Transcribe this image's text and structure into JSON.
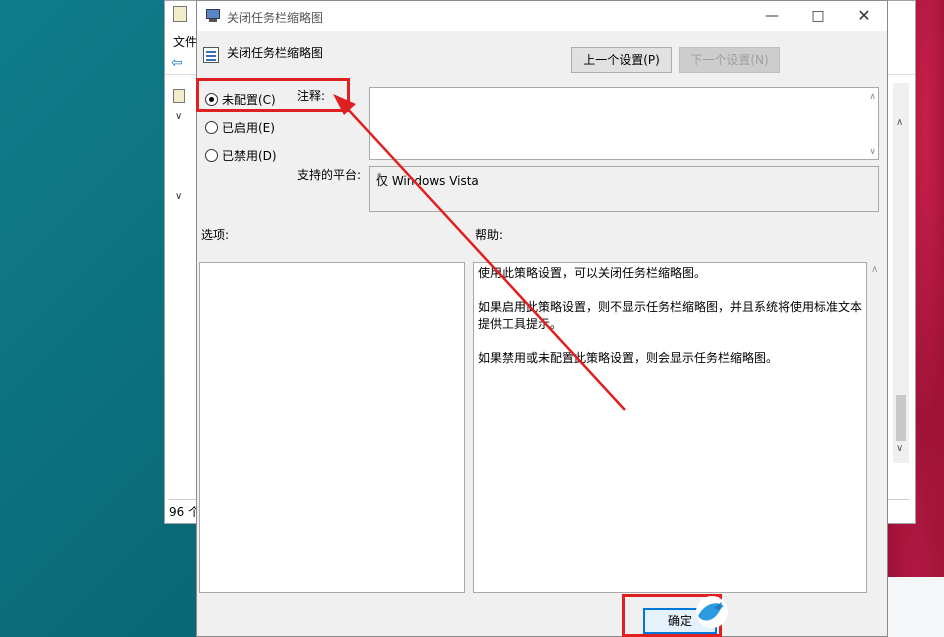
{
  "background_window": {
    "menu_file": "文件",
    "status_text": "96 个"
  },
  "dialog": {
    "title": "关闭任务栏缩略图",
    "policy_name": "关闭任务栏缩略图",
    "prev_button": "上一个设置(P)",
    "next_button": "下一个设置(N)",
    "radios": [
      {
        "label": "未配置(C)",
        "selected": true
      },
      {
        "label": "已启用(E)",
        "selected": false
      },
      {
        "label": "已禁用(D)",
        "selected": false
      }
    ],
    "comment_label": "注释:",
    "comment_value": "",
    "platform_label": "支持的平台:",
    "platform_value": "仅 Windows Vista",
    "options_label": "选项:",
    "help_label": "帮助:",
    "help_paragraphs": [
      "使用此策略设置，可以关闭任务栏缩略图。",
      "如果启用此策略设置，则不显示任务栏缩略图，并且系统将使用标准文本提供工具提示。",
      "如果禁用或未配置此策略设置，则会显示任务栏缩略图。"
    ],
    "ok_button": "确定"
  },
  "annotation_color": "#e02020",
  "accent_color": "#0078d7"
}
